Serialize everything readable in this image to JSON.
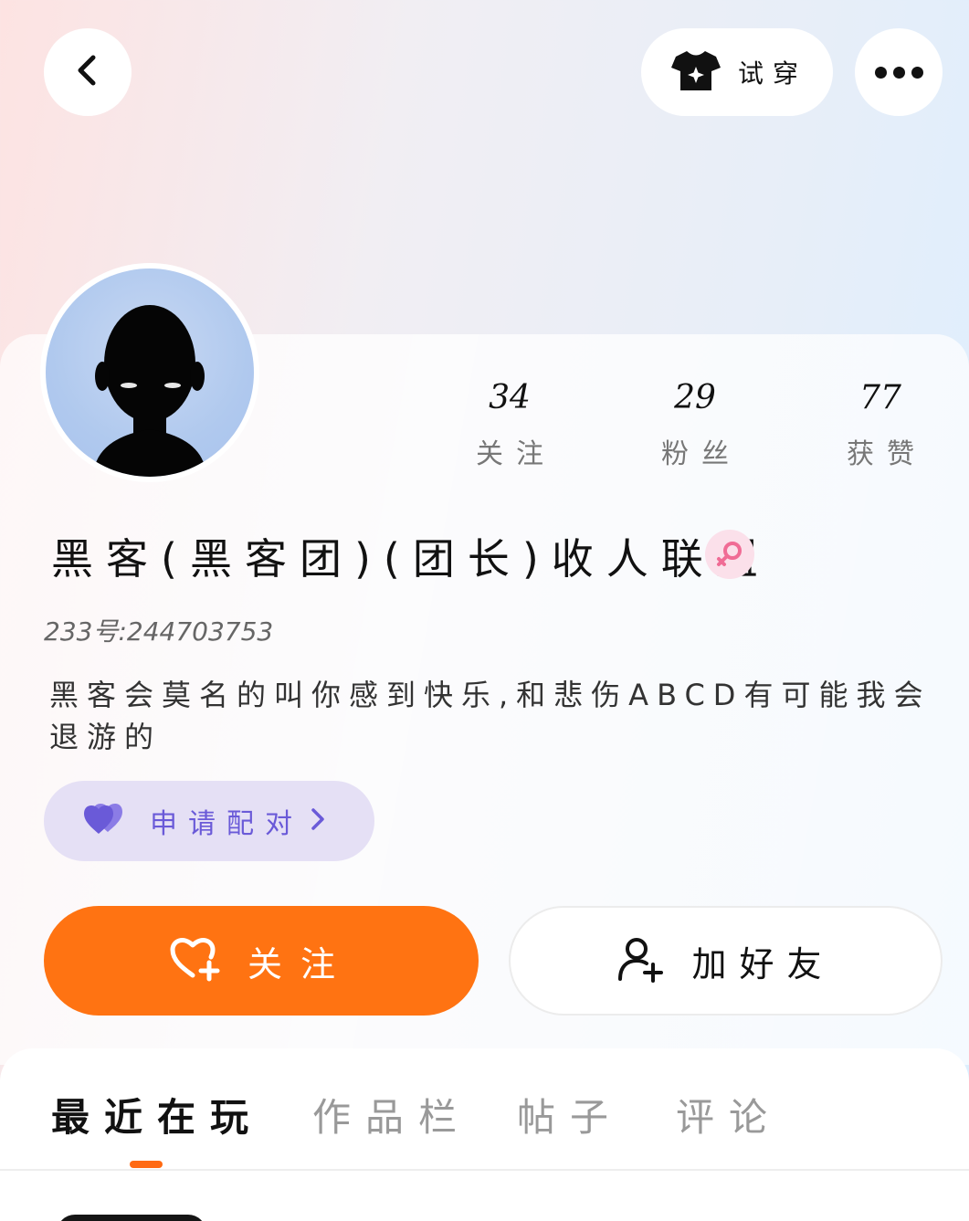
{
  "topbar": {
    "back_icon": "chevron-left-icon",
    "tryon_label": "试穿",
    "tryon_icon": "tshirt-sparkle-icon",
    "more_icon": "more-dots-icon"
  },
  "profile": {
    "stats": [
      {
        "value": "34",
        "label": "关注"
      },
      {
        "value": "29",
        "label": "粉丝"
      },
      {
        "value": "77",
        "label": "获赞"
      }
    ],
    "username": "黑客(黑客团)(团长)收人联盟",
    "gender_icon": "female-icon",
    "uid": "233号:244703753",
    "bio": "黑客会莫名的叫你感到快乐,和悲伤ABCD有可能我会退游的",
    "pair_button": {
      "label": "申请配对",
      "icon": "double-heart-icon"
    },
    "follow_button": {
      "label": "关注",
      "icon": "heart-plus-icon"
    },
    "friend_button": {
      "label": "加好友",
      "icon": "user-plus-icon"
    }
  },
  "tabs": [
    {
      "label": "最近在玩",
      "active": true
    },
    {
      "label": "作品栏",
      "active": false
    },
    {
      "label": "帖子",
      "active": false
    },
    {
      "label": "评论",
      "active": false
    }
  ],
  "colors": {
    "accent": "#ff7312",
    "pair_bg": "#e5e0f5",
    "pair_text": "#6a5ad8",
    "gender_pink": "#f06c95"
  }
}
